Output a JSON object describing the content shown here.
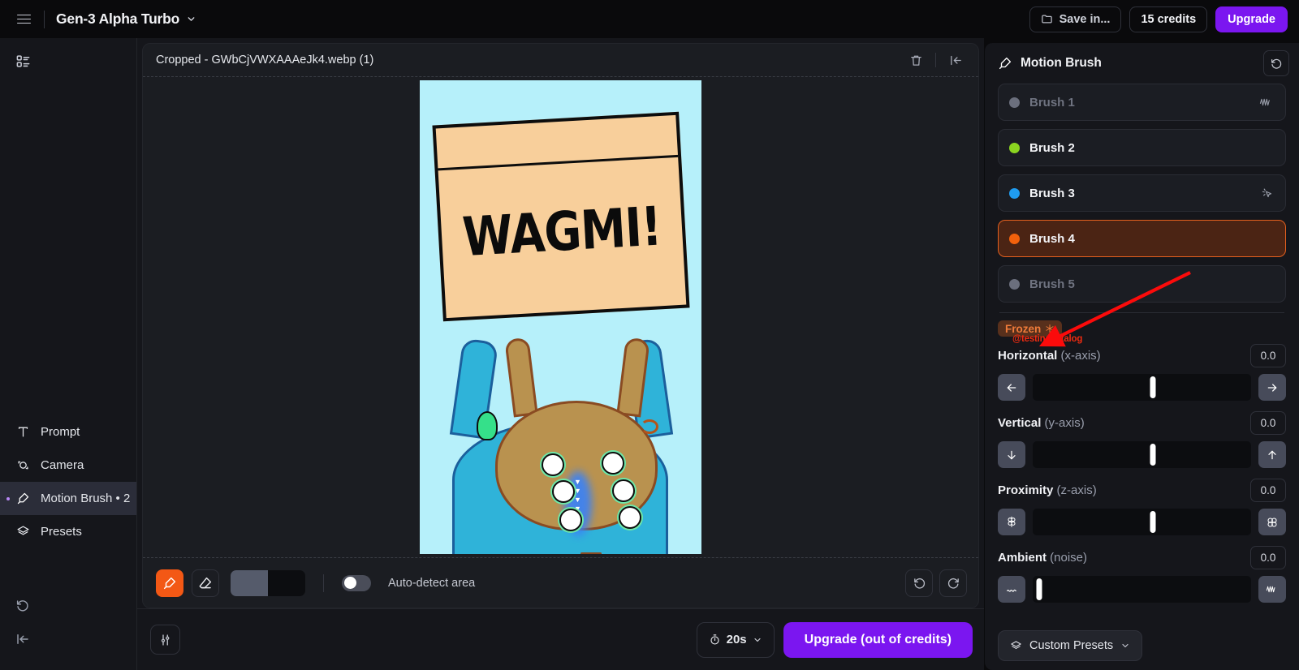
{
  "topbar": {
    "menu_icon": "hamburger-icon",
    "model_name": "Gen-3 Alpha Turbo",
    "model_chevron": "chevron-down-icon",
    "save_in_label": "Save in...",
    "save_in_icon": "folder-icon",
    "credits_label": "15 credits",
    "upgrade_label": "Upgrade",
    "accent_purple": "#7b16f0"
  },
  "sidebar": {
    "top_icon": "layout-list-icon",
    "items": [
      {
        "label": "Prompt",
        "icon": "text-t-icon",
        "active": false,
        "marked": false
      },
      {
        "label": "Camera",
        "icon": "camera-orbit-icon",
        "active": false,
        "marked": false
      },
      {
        "label": "Motion Brush • 2",
        "icon": "paint-brush-icon",
        "active": true,
        "marked": true
      },
      {
        "label": "Presets",
        "icon": "layers-icon",
        "active": false,
        "marked": false
      }
    ],
    "bottom_icons": [
      "history-undo-icon",
      "collapse-left-icon"
    ]
  },
  "canvas": {
    "title": "Cropped - GWbCjVWXAAAeJk4.webp (1)",
    "delete_icon": "trash-icon",
    "collapse_icon": "collapse-panel-icon",
    "image": {
      "sign_text": "WAGMI!",
      "sky_color": "#b6f0fa",
      "sign_color": "#f8cf9b",
      "character_color": "#2fb3d9",
      "head_color": "#b9924f"
    }
  },
  "toolbar": {
    "brush_tool_icon": "paint-brush-icon",
    "eraser_tool_icon": "eraser-icon",
    "brush_size_label": "brush-size-slider",
    "brush_size_percent": 50,
    "auto_detect_label": "Auto-detect area",
    "auto_detect_on": false,
    "undo_icon": "undo-icon",
    "redo_icon": "redo-icon",
    "active_tool_color": "#f35815"
  },
  "bottombar": {
    "settings_icon": "sliders-icon",
    "duration_label": "20s",
    "duration_icon": "stopwatch-icon",
    "duration_chevron": "chevron-down-icon",
    "generate_label": "Upgrade (out of credits)"
  },
  "motion_brush": {
    "title": "Motion Brush",
    "title_icon": "paint-brush-icon",
    "reset_icon": "reset-icon",
    "brushes": [
      {
        "label": "Brush 1",
        "color": "#6b6f7d",
        "state": "empty",
        "row_icon": "waveform-icon"
      },
      {
        "label": "Brush 2",
        "color": "#8bd420",
        "state": "filled",
        "row_icon": ""
      },
      {
        "label": "Brush 3",
        "color": "#1f9cf0",
        "state": "filled",
        "row_icon": "cursor-click-icon"
      },
      {
        "label": "Brush 4",
        "color": "#f2610c",
        "state": "selected",
        "row_icon": ""
      },
      {
        "label": "Brush 5",
        "color": "#6b6f7d",
        "state": "empty",
        "row_icon": ""
      }
    ],
    "frozen_badge": "Frozen",
    "frozen_icon": "snowflake-icon",
    "watermark": "@testingcatalog",
    "sliders": [
      {
        "name": "Horizontal",
        "sub": "(x-axis)",
        "value": "0.0",
        "percent": 50,
        "left_icon": "arrow-left-icon",
        "right_icon": "arrow-right-icon"
      },
      {
        "name": "Vertical",
        "sub": "(y-axis)",
        "value": "0.0",
        "percent": 50,
        "left_icon": "arrow-down-icon",
        "right_icon": "arrow-up-icon"
      },
      {
        "name": "Proximity",
        "sub": "(z-axis)",
        "value": "0.0",
        "percent": 50,
        "left_icon": "zoom-out-icon",
        "right_icon": "zoom-in-icon"
      },
      {
        "name": "Ambient",
        "sub": "(noise)",
        "value": "0.0",
        "percent": 2,
        "left_icon": "ambient-icon",
        "right_icon": "waveform-icon"
      }
    ],
    "presets_label": "Custom Presets",
    "presets_icon": "layers-icon",
    "presets_chevron": "chevron-down-icon",
    "selected_color": "#e4601f"
  }
}
